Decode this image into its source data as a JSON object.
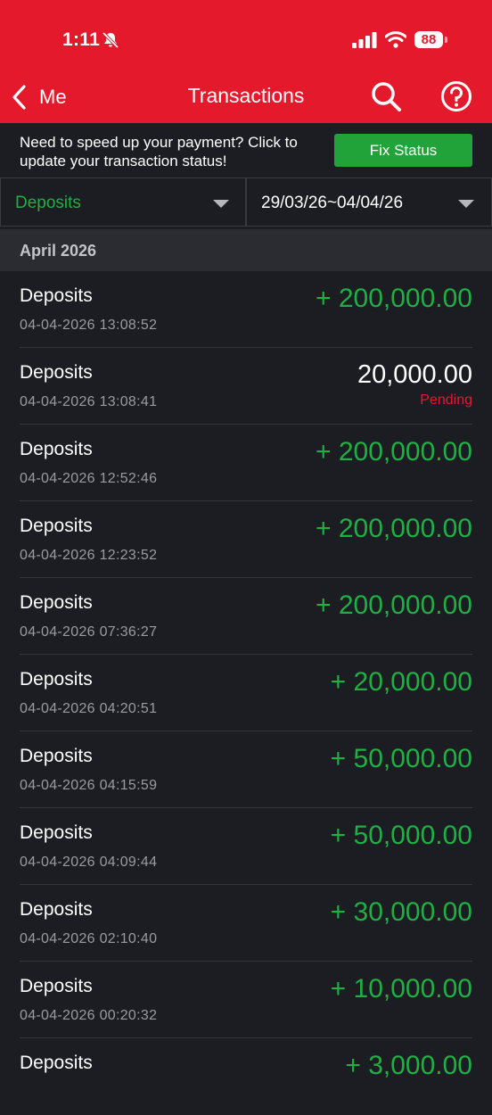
{
  "status_bar": {
    "time": "1:11",
    "battery": "88"
  },
  "nav": {
    "back_label": "Me",
    "title": "Transactions"
  },
  "banner": {
    "text": "Need to speed up your payment? Click to update your transaction status!",
    "button_label": "Fix Status"
  },
  "filters": {
    "type": "Deposits",
    "date_range": "29/03/26~04/04/26"
  },
  "section": {
    "label": "April 2026"
  },
  "transactions": [
    {
      "title": "Deposits",
      "time": "04-04-2026 13:08:52",
      "amount": "+ 200,000.00",
      "status": ""
    },
    {
      "title": "Deposits",
      "time": "04-04-2026 13:08:41",
      "amount": "20,000.00",
      "status": "Pending"
    },
    {
      "title": "Deposits",
      "time": "04-04-2026 12:52:46",
      "amount": "+ 200,000.00",
      "status": ""
    },
    {
      "title": "Deposits",
      "time": "04-04-2026 12:23:52",
      "amount": "+ 200,000.00",
      "status": ""
    },
    {
      "title": "Deposits",
      "time": "04-04-2026 07:36:27",
      "amount": "+ 200,000.00",
      "status": ""
    },
    {
      "title": "Deposits",
      "time": "04-04-2026 04:20:51",
      "amount": "+ 20,000.00",
      "status": ""
    },
    {
      "title": "Deposits",
      "time": "04-04-2026 04:15:59",
      "amount": "+ 50,000.00",
      "status": ""
    },
    {
      "title": "Deposits",
      "time": "04-04-2026 04:09:44",
      "amount": "+ 50,000.00",
      "status": ""
    },
    {
      "title": "Deposits",
      "time": "04-04-2026 02:10:40",
      "amount": "+ 30,000.00",
      "status": ""
    },
    {
      "title": "Deposits",
      "time": "04-04-2026 00:20:32",
      "amount": "+ 10,000.00",
      "status": ""
    },
    {
      "title": "Deposits",
      "time": "",
      "amount": "+ 3,000.00",
      "status": ""
    }
  ],
  "colors": {
    "header": "#e5192c",
    "positive": "#1fb043",
    "pending": "#e5192c",
    "background": "#1c1d22"
  },
  "icons": [
    "bell-slash-icon",
    "signal-icon",
    "wifi-icon",
    "battery-icon",
    "chevron-left-icon",
    "search-icon",
    "help-icon",
    "caret-down-icon"
  ]
}
